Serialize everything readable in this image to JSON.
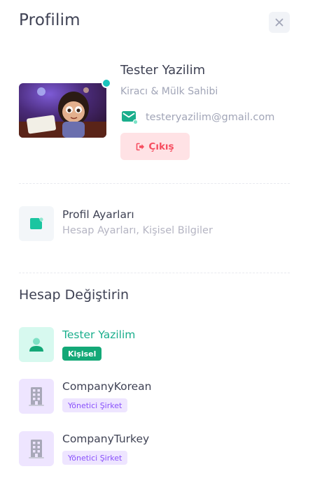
{
  "panel": {
    "title": "Profilim"
  },
  "user": {
    "name": "Tester Yazilim",
    "role": "Kiracı & Mülk Sahibi",
    "email": "testeryazilim@gmail.com",
    "online": true
  },
  "actions": {
    "logout_label": "Çıkış"
  },
  "settings_item": {
    "title": "Profil Ayarları",
    "subtitle": "Hesap Ayarları, Kişisel Bilgiler",
    "icon": "settings-card-icon"
  },
  "accounts": {
    "title": "Hesap Değiştirin",
    "items": [
      {
        "name": "Tester Yazilim",
        "badge": "Kişisel",
        "icon": "user-icon",
        "active": true
      },
      {
        "name": "CompanyKorean",
        "badge": "Yönetici Şirket",
        "icon": "building-icon",
        "active": false
      },
      {
        "name": "CompanyTurkey",
        "badge": "Yönetici Şirket",
        "icon": "building-icon",
        "active": false
      }
    ]
  },
  "colors": {
    "accent_green": "#1aae8c",
    "online": "#1bc5bd",
    "danger": "#f64e60",
    "danger_light": "#ffe2e5",
    "purple": "#8950fc",
    "purple_light": "#eee5ff"
  }
}
